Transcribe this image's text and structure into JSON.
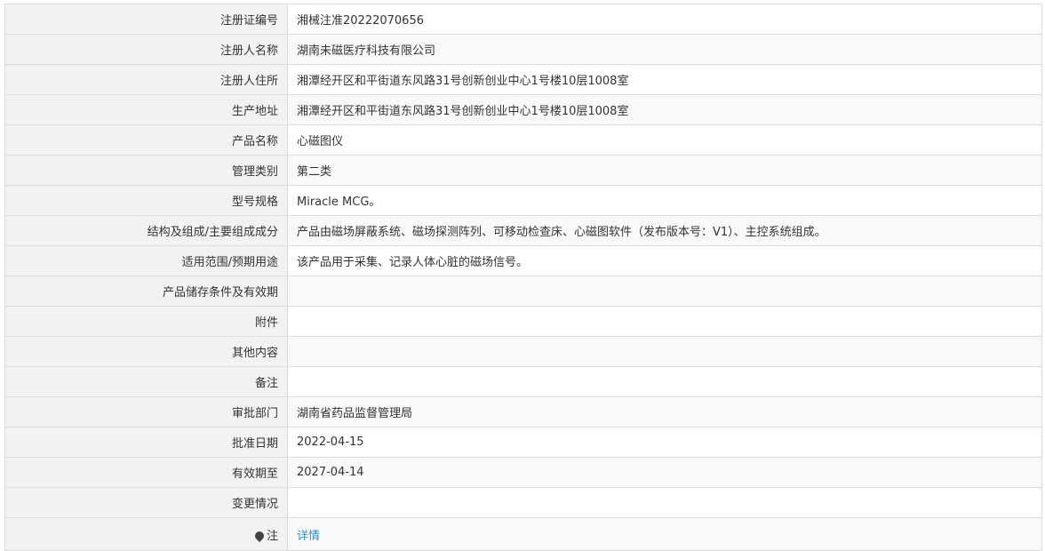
{
  "rows": [
    {
      "label": "注册证编号",
      "value": "湘械注准20222070656"
    },
    {
      "label": "注册人名称",
      "value": "湖南未磁医疗科技有限公司"
    },
    {
      "label": "注册人住所",
      "value": "湘潭经开区和平街道东风路31号创新创业中心1号楼10层1008室"
    },
    {
      "label": "生产地址",
      "value": "湘潭经开区和平街道东风路31号创新创业中心1号楼10层1008室"
    },
    {
      "label": "产品名称",
      "value": "心磁图仪"
    },
    {
      "label": "管理类别",
      "value": "第二类"
    },
    {
      "label": "型号规格",
      "value": "Miracle MCG。"
    },
    {
      "label": "结构及组成/主要组成成分",
      "value": "产品由磁场屏蔽系统、磁场探测阵列、可移动检查床、心磁图软件（发布版本号：V1）、主控系统组成。"
    },
    {
      "label": "适用范围/预期用途",
      "value": "该产品用于采集、记录人体心脏的磁场信号。"
    },
    {
      "label": "产品储存条件及有效期",
      "value": ""
    },
    {
      "label": "附件",
      "value": ""
    },
    {
      "label": "其他内容",
      "value": ""
    },
    {
      "label": "备注",
      "value": ""
    },
    {
      "label": "审批部门",
      "value": "湖南省药品监督管理局"
    },
    {
      "label": "批准日期",
      "value": "2022-04-15"
    },
    {
      "label": "有效期至",
      "value": "2027-04-14"
    },
    {
      "label": "变更情况",
      "value": ""
    }
  ],
  "note": {
    "label": "注",
    "icon": "pin-icon",
    "link_text": "详情"
  }
}
